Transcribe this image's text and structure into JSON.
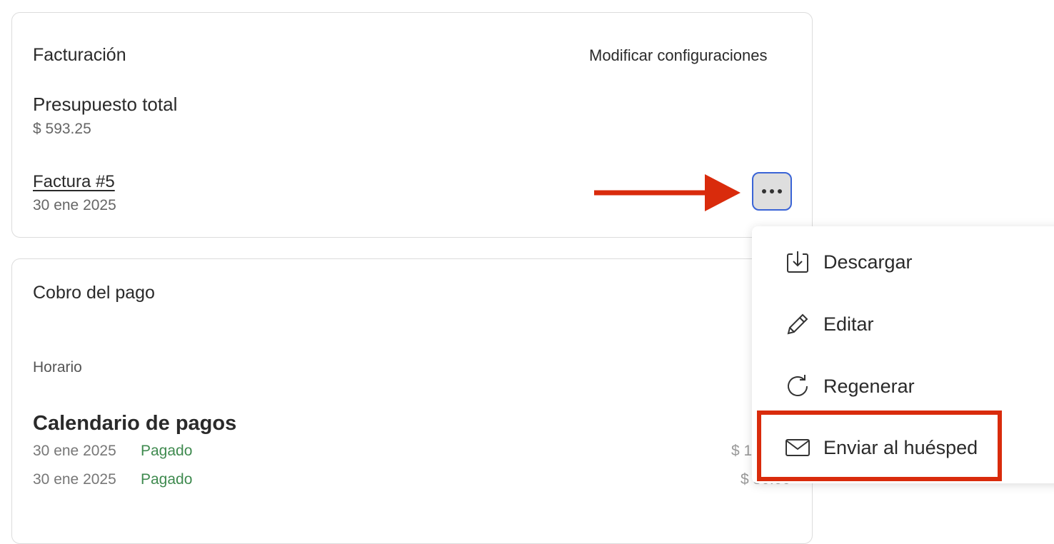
{
  "billing": {
    "title": "Facturación",
    "modify_settings": "Modificar configuraciones",
    "total_budget_label": "Presupuesto total",
    "total_budget_value": "$ 593.25",
    "invoice_link": "Factura #5",
    "invoice_date": "30 ene 2025"
  },
  "payment": {
    "title": "Cobro del pago",
    "schedule_label": "Horario",
    "calendar_title": "Calendario de pagos",
    "rows": [
      {
        "date": "30 ene 2025",
        "status": "Pagado",
        "amount": "$ 1"
      },
      {
        "date": "30 ene 2025",
        "status": "Pagado",
        "amount": "$ 30.00"
      }
    ]
  },
  "menu": {
    "items": [
      {
        "label": "Descargar",
        "icon": "download-icon"
      },
      {
        "label": "Editar",
        "icon": "pencil-icon"
      },
      {
        "label": "Regenerar",
        "icon": "refresh-icon"
      },
      {
        "label": "Enviar al huésped",
        "icon": "mail-icon"
      }
    ]
  },
  "colors": {
    "accent_blue": "#3a64d6",
    "annotation_red": "#d92b0c",
    "status_green": "#3f8a4f"
  }
}
